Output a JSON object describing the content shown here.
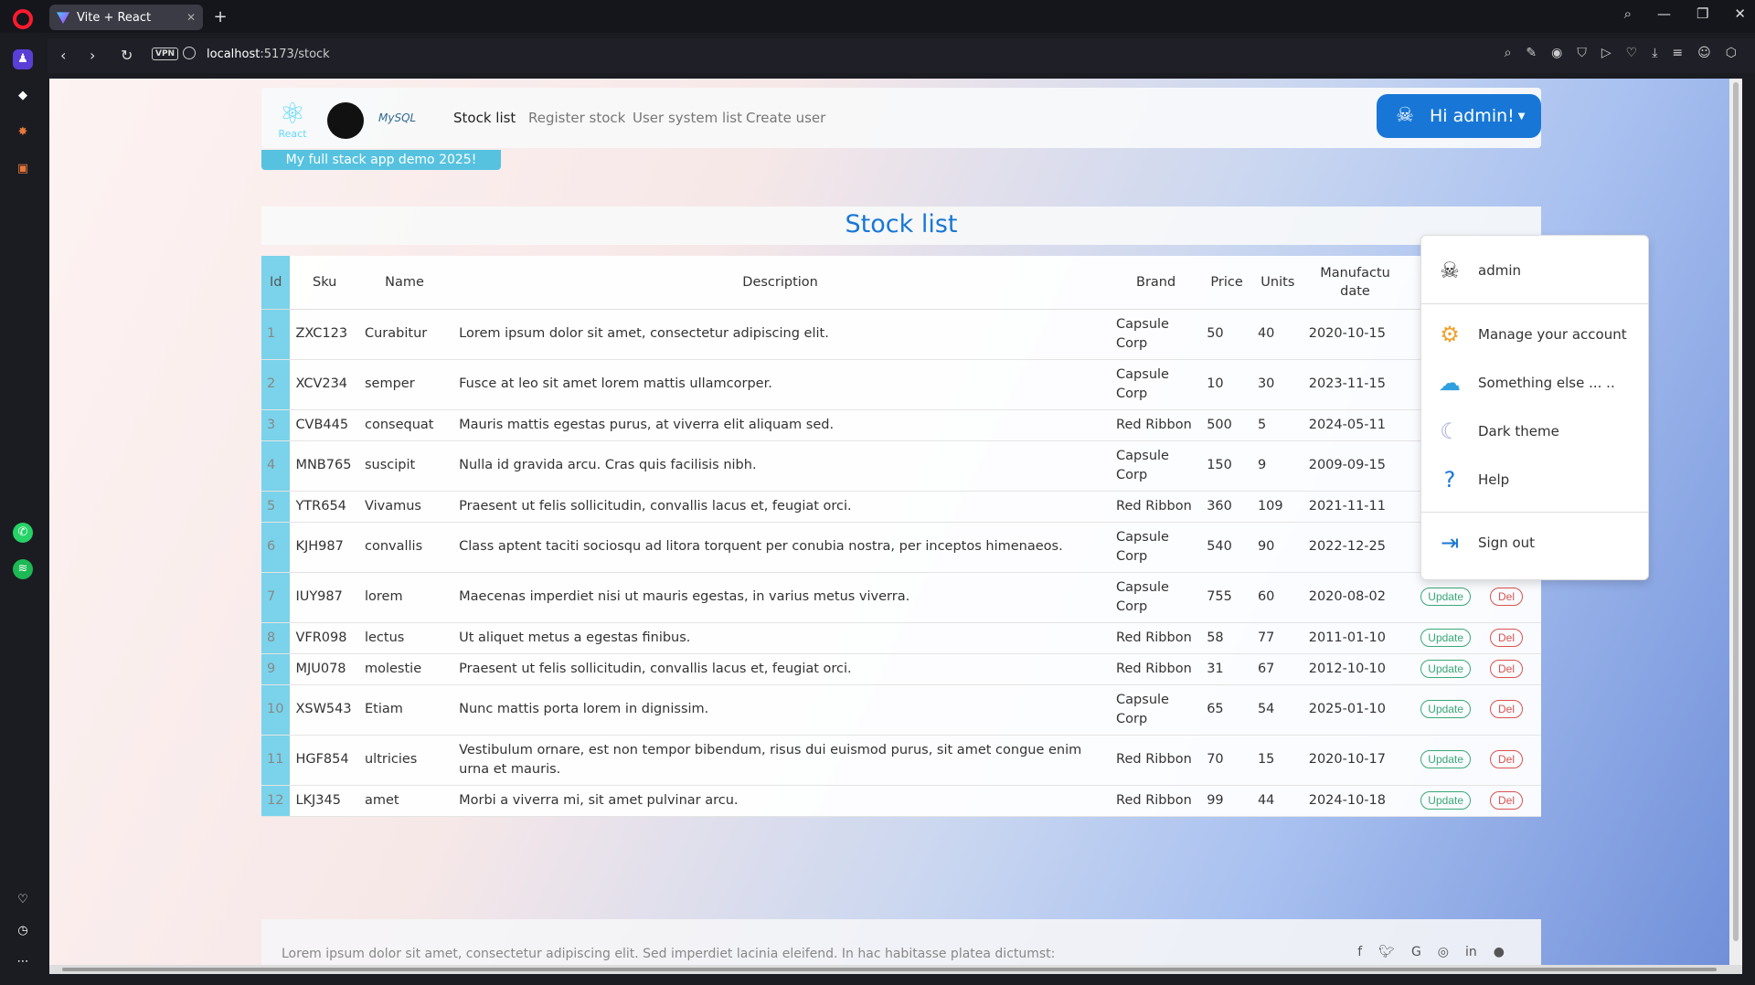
{
  "browser": {
    "tab_title": "Vite + React",
    "url_host": "localhost",
    "url_rest": ":5173/stock",
    "vpn_label": "VPN"
  },
  "navbar": {
    "logo_react_label": "React",
    "logo_mysql_label": "MySQL",
    "links": [
      "Stock list",
      "Register stock",
      "User system list",
      "Create user"
    ],
    "user_button": "Hi admin!"
  },
  "badge": "My full stack app demo 2025!",
  "page_title": "Stock list",
  "table": {
    "headers": [
      "Id",
      "Sku",
      "Name",
      "Description",
      "Brand",
      "Price",
      "Units",
      "Manufactu date"
    ],
    "update_label": "Update",
    "delete_label": "Del",
    "rows": [
      {
        "id": "1",
        "sku": "ZXC123",
        "name": "Curabitur",
        "desc": "Lorem ipsum dolor sit amet, consectetur adipiscing elit.",
        "brand": "Capsule Corp",
        "price": "50",
        "units": "40",
        "date": "2020-10-15"
      },
      {
        "id": "2",
        "sku": "XCV234",
        "name": "semper",
        "desc": "Fusce at leo sit amet lorem mattis ullamcorper.",
        "brand": "Capsule Corp",
        "price": "10",
        "units": "30",
        "date": "2023-11-15"
      },
      {
        "id": "3",
        "sku": "CVB445",
        "name": "consequat",
        "desc": "Mauris mattis egestas purus, at viverra elit aliquam sed.",
        "brand": "Red Ribbon",
        "price": "500",
        "units": "5",
        "date": "2024-05-11"
      },
      {
        "id": "4",
        "sku": "MNB765",
        "name": "suscipit",
        "desc": "Nulla id gravida arcu. Cras quis facilisis nibh.",
        "brand": "Capsule Corp",
        "price": "150",
        "units": "9",
        "date": "2009-09-15"
      },
      {
        "id": "5",
        "sku": "YTR654",
        "name": "Vivamus",
        "desc": "Praesent ut felis sollicitudin, convallis lacus et, feugiat orci.",
        "brand": "Red Ribbon",
        "price": "360",
        "units": "109",
        "date": "2021-11-11"
      },
      {
        "id": "6",
        "sku": "KJH987",
        "name": "convallis",
        "desc": "Class aptent taciti sociosqu ad litora torquent per conubia nostra, per inceptos himenaeos.",
        "brand": "Capsule Corp",
        "price": "540",
        "units": "90",
        "date": "2022-12-25"
      },
      {
        "id": "7",
        "sku": "IUY987",
        "name": "lorem",
        "desc": "Maecenas imperdiet nisi ut mauris egestas, in varius metus viverra.",
        "brand": "Capsule Corp",
        "price": "755",
        "units": "60",
        "date": "2020-08-02"
      },
      {
        "id": "8",
        "sku": "VFR098",
        "name": "lectus",
        "desc": "Ut aliquet metus a egestas finibus.",
        "brand": "Red Ribbon",
        "price": "58",
        "units": "77",
        "date": "2011-01-10"
      },
      {
        "id": "9",
        "sku": "MJU078",
        "name": "molestie",
        "desc": "Praesent ut felis sollicitudin, convallis lacus et, feugiat orci.",
        "brand": "Red Ribbon",
        "price": "31",
        "units": "67",
        "date": "2012-10-10"
      },
      {
        "id": "10",
        "sku": "XSW543",
        "name": "Etiam",
        "desc": "Nunc mattis porta lorem in dignissim.",
        "brand": "Capsule Corp",
        "price": "65",
        "units": "54",
        "date": "2025-01-10"
      },
      {
        "id": "11",
        "sku": "HGF854",
        "name": "ultricies",
        "desc": "Vestibulum ornare, est non tempor bibendum, risus dui euismod purus, sit amet congue enim urna et mauris.",
        "brand": "Red Ribbon",
        "price": "70",
        "units": "15",
        "date": "2020-10-17"
      },
      {
        "id": "12",
        "sku": "LKJ345",
        "name": "amet",
        "desc": "Morbi a viverra mi, sit amet pulvinar arcu.",
        "brand": "Red Ribbon",
        "price": "99",
        "units": "44",
        "date": "2024-10-18"
      }
    ]
  },
  "dropdown": {
    "username": "admin",
    "items": [
      "Manage your account",
      "Something else ... ..",
      "Dark theme",
      "Help"
    ],
    "signout": "Sign out"
  },
  "footer": {
    "text": "Lorem ipsum dolor sit amet, consectetur adipiscing elit. Sed imperdiet lacinia eleifend. In hac habitasse platea dictumst:"
  },
  "colors": {
    "primary": "#1877d6",
    "accent": "#7ad3ea",
    "success": "#3aa876",
    "danger": "#d9534f"
  }
}
